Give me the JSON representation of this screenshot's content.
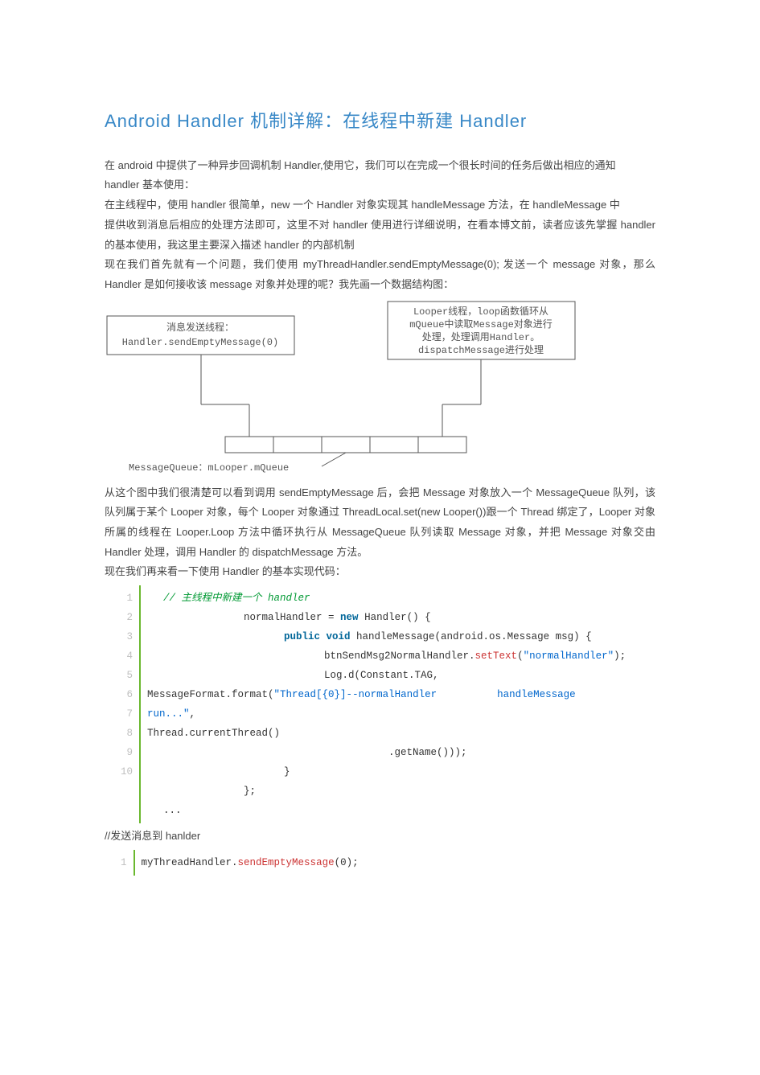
{
  "title": "Android Handler 机制详解：在线程中新建 Handler",
  "paras": {
    "p1": "在 android 中提供了一种异步回调机制 Handler,使用它，我们可以在完成一个很长时间的任务后做出相应的通知",
    "p2": "handler 基本使用：",
    "p3": "在主线程中，使用 handler 很简单，new 一个 Handler 对象实现其 handleMessage 方法，在 handleMessage 中",
    "p4": "提供收到消息后相应的处理方法即可，这里不对 handler 使用进行详细说明，在看本博文前，读者应该先掌握 handler 的基本使用，我这里主要深入描述 handler 的内部机制",
    "p5": "现在我们首先就有一个问题，我们使用 myThreadHandler.sendEmptyMessage(0); 发送一个 message 对象，那么 Handler 是如何接收该 message 对象并处理的呢？我先画一个数据结构图：",
    "p6": "从这个图中我们很清楚可以看到调用 sendEmptyMessage 后，会把 Message 对象放入一个 MessageQueue 队列，该队列属于某个 Looper 对象，每个 Looper 对象通过 ThreadLocal.set(new Looper())跟一个 Thread 绑定了，Looper 对象所属的线程在 Looper.Loop 方法中循环执行从 MessageQueue 队列读取 Message 对象，并把 Message 对象交由 Handler 处理，调用 Handler 的 dispatchMessage 方法。",
    "p7": "现在我们再来看一下使用 Handler 的基本实现代码：",
    "p_send": "//发送消息到 hanlder"
  },
  "diagram": {
    "box1_l1": "消息发送线程：",
    "box1_l2": "Handler.sendEmptyMessage(0)",
    "box2_l1": "Looper线程，loop函数循环从",
    "box2_l2": "mQueue中读取Message对象进行",
    "box2_l3": "处理，处理调用Handler。",
    "box2_l4": "dispatchMessage进行处理",
    "queue_label": "MessageQueue：mLooper.mQueue"
  },
  "code1": {
    "lines": [
      "1",
      "2",
      "3",
      "4",
      "5",
      "6",
      "7",
      "8",
      "9",
      "10"
    ],
    "c1": "// 主线程中新建一个 handler",
    "c2": "normalHandler = ",
    "c2kw": "new",
    "c2b": " Handler() {",
    "c3a": "public void",
    "c3b": " handleMessage(android.os.Message msg) {",
    "c4a": "btnSendMsg2NormalHandler.",
    "c4fn": "setText",
    "c4b": "(",
    "c4str": "\"normalHandler\"",
    "c4c": ");",
    "c5": "Log.d(Constant.TAG,",
    "c6a": "MessageFormat.format(",
    "c6str": "\"Thread[{0}]--normalHandler          handleMessage          run...\"",
    "c6b": ",",
    "c7": "Thread.currentThread()",
    "c8": ".getName()));",
    "c9": "}",
    "c10": "};",
    "c11": "..."
  },
  "code2": {
    "line": "1",
    "a": "myThreadHandler.",
    "fn": "sendEmptyMessage",
    "b": "(0);"
  }
}
